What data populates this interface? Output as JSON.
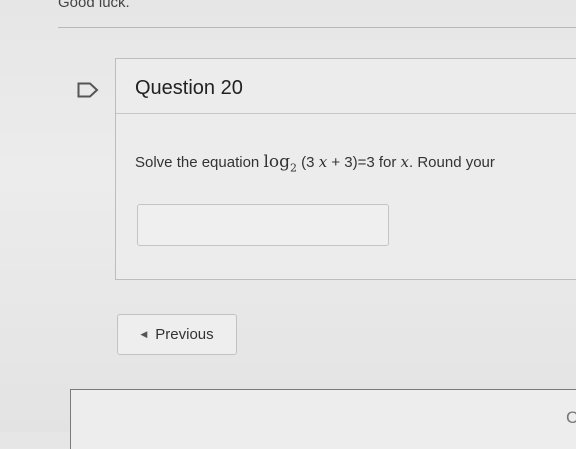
{
  "header": {
    "good_luck": "Good luck."
  },
  "question": {
    "title": "Question 20",
    "prompt_before": "Solve the equation ",
    "math_func": "log",
    "math_base": "2",
    "math_open": " (3 ",
    "math_var": "x",
    "math_rest": " + 3)=3",
    "prompt_mid": " for ",
    "var_x": "x",
    "prompt_after": ". Round your",
    "answer_value": ""
  },
  "navigation": {
    "previous_label": "Previous"
  },
  "footer": {
    "partial_text": "C"
  }
}
